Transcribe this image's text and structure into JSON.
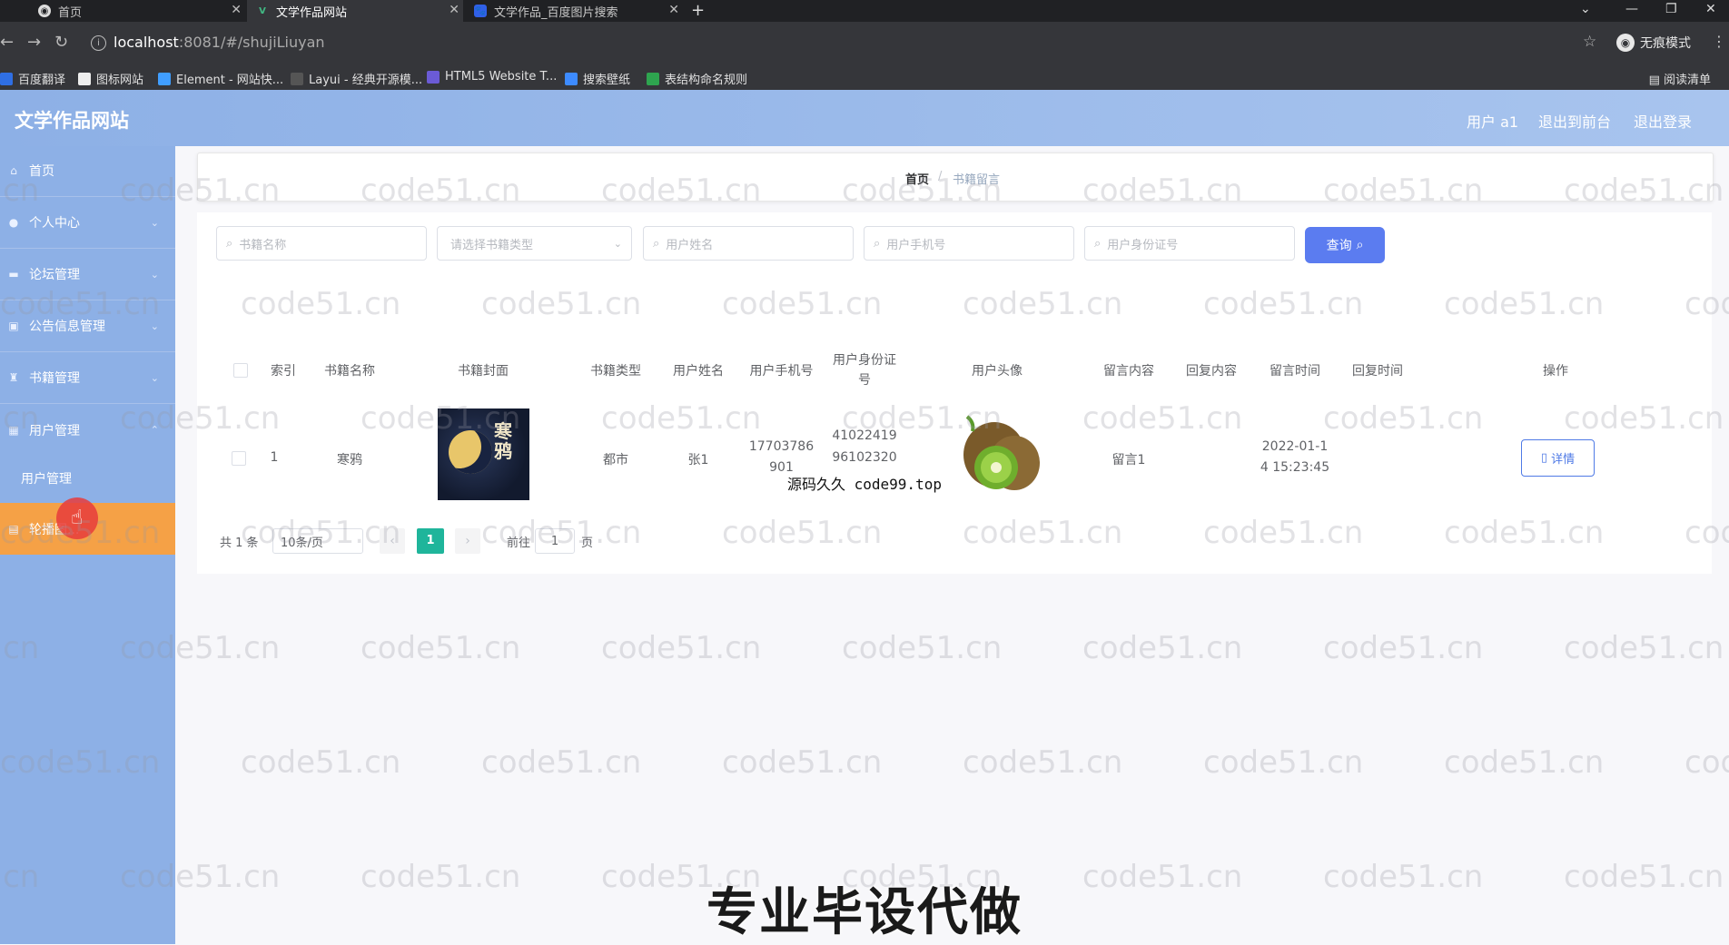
{
  "browser": {
    "tabs": [
      {
        "title": "首页"
      },
      {
        "title": "文学作品网站"
      },
      {
        "title": "文学作品_百度图片搜索"
      }
    ],
    "url_host": "localhost",
    "url_rest": ":8081/#/shujiLiuyan",
    "incognito_label": "无痕模式",
    "bookmarks": [
      "百度翻译",
      "图标网站",
      "Element - 网站快...",
      "Layui - 经典开源模...",
      "HTML5 Website T...",
      "搜索壁纸",
      "表结构命名规则"
    ],
    "reading_list": "阅读清单"
  },
  "app": {
    "title": "文学作品网站",
    "header_links": [
      "用户 a1",
      "退出到前台",
      "退出登录"
    ]
  },
  "sidebar": {
    "items": [
      {
        "label": "首页",
        "icon": "home-icon"
      },
      {
        "label": "个人中心",
        "icon": "user-icon"
      },
      {
        "label": "论坛管理",
        "icon": "forum-icon"
      },
      {
        "label": "公告信息管理",
        "icon": "notice-icon"
      },
      {
        "label": "书籍管理",
        "icon": "book-icon"
      },
      {
        "label": "用户管理",
        "icon": "users-icon"
      }
    ],
    "subitem": "用户管理",
    "active_item": "轮播图..."
  },
  "breadcrumb": {
    "home": "首页",
    "current": "书籍留言"
  },
  "search": {
    "book_name_placeholder": "书籍名称",
    "book_type_placeholder": "请选择书籍类型",
    "user_name_placeholder": "用户姓名",
    "user_phone_placeholder": "用户手机号",
    "user_id_placeholder": "用户身份证号",
    "query_label": "查询"
  },
  "table": {
    "headers": [
      "索引",
      "书籍名称",
      "书籍封面",
      "书籍类型",
      "用户姓名",
      "用户手机号",
      "用户身份证号",
      "用户头像",
      "留言内容",
      "回复内容",
      "留言时间",
      "回复时间",
      "操作"
    ],
    "rows": [
      {
        "index": "1",
        "book_name": "寒鸦",
        "cover_title": "寒鸦",
        "book_type": "都市",
        "user_name": "张1",
        "phone_l1": "17703786",
        "phone_l2": "901",
        "idcard_l1": "41022419",
        "idcard_l2": "96102320",
        "message": "留言1",
        "reply": "",
        "time_l1": "2022-01-1",
        "time_l2": "4 15:23:45",
        "reply_time": "",
        "action": "详情"
      }
    ]
  },
  "pagination": {
    "total": "共 1 条",
    "page_size": "10条/页",
    "current": "1",
    "goto_prefix": "前往",
    "goto_value": "1",
    "goto_suffix": "页"
  },
  "overlay": {
    "source_note": "源码久久 code99.top",
    "banner": "专业毕设代做",
    "watermark": "code51.cn"
  },
  "colors": {
    "header": "#8db0e6",
    "active_menu": "#f5a146",
    "query_button": "#5b7cf0",
    "pagination_active": "#1fb59b",
    "detail_button": "#4f7ae6"
  }
}
